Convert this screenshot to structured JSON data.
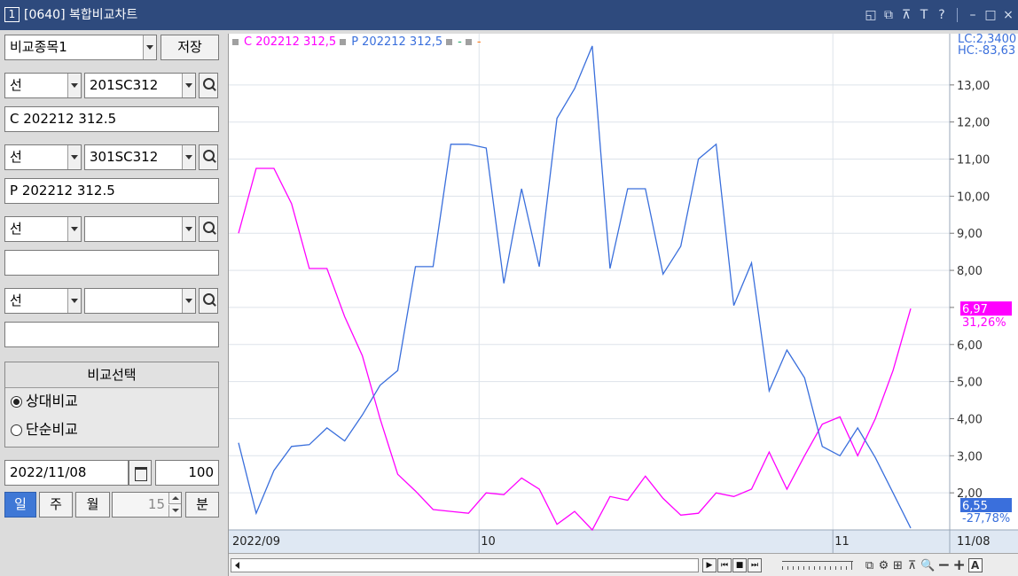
{
  "window": {
    "number": "1",
    "title": "[0640]  복합비교차트",
    "icons": [
      "restore-panel-icon",
      "copy-window-icon",
      "pin-icon",
      "text-icon",
      "help-icon",
      "minimize-icon",
      "maximize-icon",
      "close-icon"
    ],
    "icon_glyphs": [
      "◱",
      "⧉",
      "⊼",
      "T",
      "?",
      "–",
      "□",
      "×"
    ]
  },
  "panel": {
    "compare_item": "비교종목1",
    "save_label": "저장",
    "rows": [
      {
        "type": "선",
        "code": "201SC312",
        "name": "C 202212 312.5"
      },
      {
        "type": "선",
        "code": "301SC312",
        "name": "P 202212 312.5"
      },
      {
        "type": "선",
        "code": "",
        "name": ""
      },
      {
        "type": "선",
        "code": "",
        "name": ""
      }
    ],
    "compare_select": {
      "title": "비교선택",
      "options": [
        "상대비교",
        "단순비교"
      ],
      "selected": 0
    },
    "date": "2022/11/08",
    "count": "100",
    "periods": [
      "일",
      "주",
      "월"
    ],
    "active_period": 0,
    "minutes_value": "15",
    "minutes_label": "분"
  },
  "legend": {
    "items": [
      {
        "text": "C 202212 312,5",
        "color": "#ff00ff"
      },
      {
        "text": "P 202212 312,5",
        "color": "#3a6fdc"
      },
      {
        "text": "-",
        "color": "#22a86a"
      },
      {
        "text": "-",
        "color": "#ff7a1a"
      }
    ]
  },
  "readout": {
    "lc": "LC:2,3400",
    "hc": "HC:-83,63"
  },
  "colors": {
    "call": "#ff00ff",
    "put": "#3a6fdc",
    "grid": "#dde3ea",
    "axis_bg": "#dfe8f3"
  },
  "toolbar": {
    "player": [
      "▶",
      "⏮",
      "■",
      "⏭"
    ],
    "tools": [
      "⧉",
      "⚙",
      "⊞",
      "⊼",
      "🔍",
      "−",
      "+",
      "A"
    ],
    "tool_names": [
      "layout-icon",
      "settings-icon",
      "grid-icon",
      "pin-icon",
      "zoom-icon",
      "zoom-out-icon",
      "zoom-in-icon",
      "auto-scale-icon"
    ]
  },
  "chart_data": {
    "type": "line",
    "ylim": [
      1.0,
      14.0
    ],
    "y_ticks": [
      2,
      3,
      4,
      5,
      6,
      7,
      8,
      9,
      10,
      11,
      12,
      13
    ],
    "y_tick_labels": [
      "2,00",
      "3,00",
      "4,00",
      "5,00",
      "6,00",
      "",
      "8,00",
      "9,00",
      "10,00",
      "11,00",
      "12,00",
      "13,00"
    ],
    "x_labels": [
      {
        "label": "2022/09",
        "index": 0
      },
      {
        "label": "10",
        "index": 14
      },
      {
        "label": "11",
        "index": 34
      },
      {
        "label": "11/08",
        "index": 39
      }
    ],
    "series": [
      {
        "name": "C 202212 312,5",
        "color": "#ff00ff",
        "values": [
          9.0,
          10.75,
          10.75,
          9.8,
          8.05,
          8.05,
          6.75,
          5.7,
          4.0,
          2.5,
          2.05,
          1.55,
          1.5,
          1.45,
          2.0,
          1.95,
          2.4,
          2.1,
          1.15,
          1.5,
          1.0,
          1.9,
          1.8,
          2.45,
          1.85,
          1.4,
          1.45,
          2.0,
          1.9,
          2.1,
          3.1,
          2.1,
          3.0,
          3.85,
          4.05,
          3.0,
          4.0,
          5.3,
          6.97
        ],
        "last_value": "6,97",
        "last_pct": "31,26%"
      },
      {
        "name": "P 202212 312,5",
        "color": "#3a6fdc",
        "values": [
          3.35,
          1.45,
          2.6,
          3.25,
          3.3,
          3.75,
          3.4,
          4.1,
          4.9,
          5.3,
          8.1,
          8.1,
          11.4,
          11.4,
          11.3,
          7.65,
          10.2,
          8.1,
          12.1,
          12.9,
          14.05,
          8.05,
          10.2,
          10.2,
          7.9,
          8.65,
          11.0,
          11.4,
          7.05,
          8.2,
          4.75,
          5.85,
          5.1,
          3.25,
          3.0,
          3.75,
          2.95,
          2.0,
          1.05
        ],
        "last_value": "6,55",
        "last_pct": "-27,78%"
      }
    ]
  }
}
